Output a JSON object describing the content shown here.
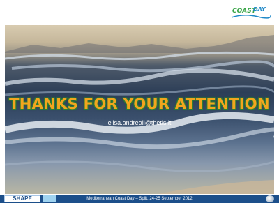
{
  "logo": {
    "text": "COAST DAY"
  },
  "slide": {
    "headline": "THANKS FOR YOUR ATTENTION",
    "email": "elisa.andreoli@thetis.it"
  },
  "footer": {
    "left_logo": "SHAPE",
    "text": "Mediterranean Coast Day – Split, 24-25 September 2012"
  },
  "colors": {
    "headline": "#f2a51e",
    "headline_outline": "#2e7d32",
    "footer_bar": "#1c4f8a",
    "logo_green": "#3aa548",
    "logo_blue": "#1e88c8"
  },
  "icons": [
    "coast-day-logo",
    "shape-logo",
    "eu-flag-icon",
    "globe-icon"
  ]
}
